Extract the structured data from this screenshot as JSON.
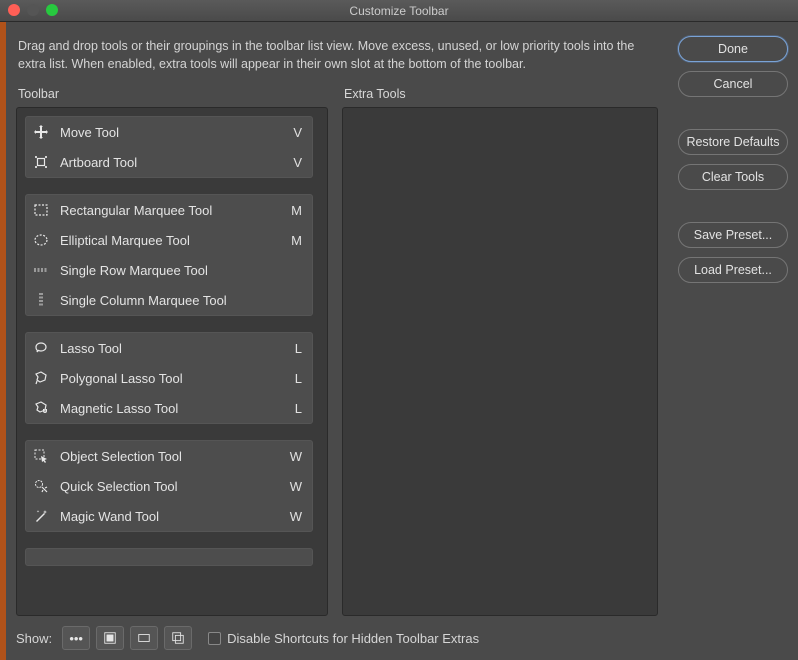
{
  "window": {
    "title": "Customize Toolbar"
  },
  "description": "Drag and drop tools or their groupings in the toolbar list view. Move excess, unused, or low priority tools into the extra list. When enabled, extra tools will appear in their own slot at the bottom of the toolbar.",
  "columns": {
    "toolbar_header": "Toolbar",
    "extra_header": "Extra Tools"
  },
  "groups": [
    {
      "tools": [
        {
          "icon": "move-icon",
          "label": "Move Tool",
          "key": "V"
        },
        {
          "icon": "artboard-icon",
          "label": "Artboard Tool",
          "key": "V"
        }
      ]
    },
    {
      "tools": [
        {
          "icon": "rect-marquee-icon",
          "label": "Rectangular Marquee Tool",
          "key": "M"
        },
        {
          "icon": "ellipse-marquee-icon",
          "label": "Elliptical Marquee Tool",
          "key": "M"
        },
        {
          "icon": "single-row-marquee-icon",
          "label": "Single Row Marquee Tool",
          "key": ""
        },
        {
          "icon": "single-col-marquee-icon",
          "label": "Single Column Marquee Tool",
          "key": ""
        }
      ]
    },
    {
      "tools": [
        {
          "icon": "lasso-icon",
          "label": "Lasso Tool",
          "key": "L"
        },
        {
          "icon": "polygonal-lasso-icon",
          "label": "Polygonal Lasso Tool",
          "key": "L"
        },
        {
          "icon": "magnetic-lasso-icon",
          "label": "Magnetic Lasso Tool",
          "key": "L"
        }
      ]
    },
    {
      "tools": [
        {
          "icon": "object-selection-icon",
          "label": "Object Selection Tool",
          "key": "W"
        },
        {
          "icon": "quick-selection-icon",
          "label": "Quick Selection Tool",
          "key": "W"
        },
        {
          "icon": "magic-wand-icon",
          "label": "Magic Wand Tool",
          "key": "W"
        }
      ]
    }
  ],
  "buttons": {
    "done": "Done",
    "cancel": "Cancel",
    "restore": "Restore Defaults",
    "clear": "Clear Tools",
    "save_preset": "Save Preset...",
    "load_preset": "Load Preset..."
  },
  "footer": {
    "show_label": "Show:",
    "checkbox_label": "Disable Shortcuts for Hidden Toolbar Extras"
  }
}
